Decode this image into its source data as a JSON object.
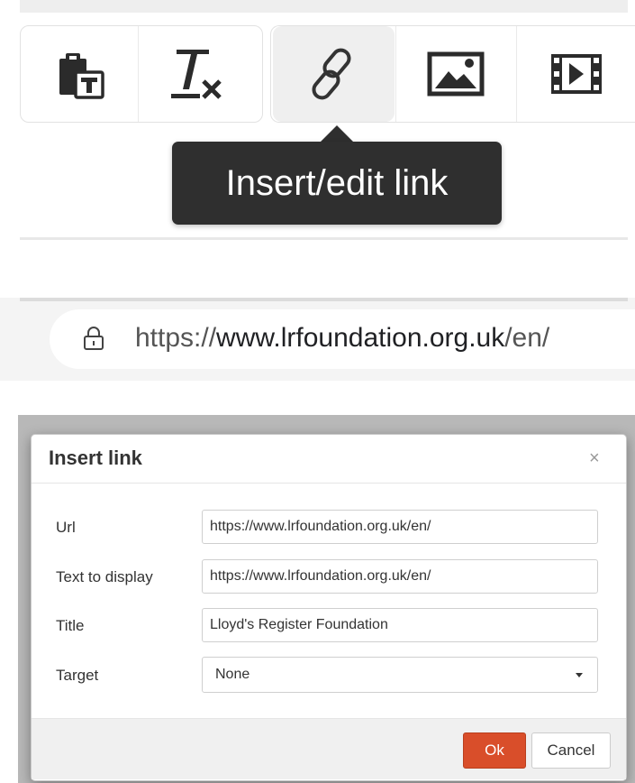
{
  "toolbar": {
    "buttons": [
      {
        "name": "paste-as-text",
        "icon": "clipboard-text-icon"
      },
      {
        "name": "clear-formatting",
        "icon": "remove-format-icon"
      },
      {
        "name": "insert-link",
        "icon": "link-icon",
        "active": true
      },
      {
        "name": "insert-image",
        "icon": "image-icon"
      },
      {
        "name": "insert-media",
        "icon": "film-icon"
      }
    ],
    "tooltip": "Insert/edit link"
  },
  "address_bar": {
    "scheme": "https://",
    "host": "www.lrfoundation.org.uk",
    "path": "/en/",
    "icon": "lock-icon"
  },
  "dialog": {
    "title": "Insert link",
    "close_glyph": "×",
    "fields": {
      "url": {
        "label": "Url",
        "value": "https://www.lrfoundation.org.uk/en/"
      },
      "text": {
        "label": "Text to display",
        "value": "https://www.lrfoundation.org.uk/en/"
      },
      "title": {
        "label": "Title",
        "value": "Lloyd's Register Foundation"
      },
      "target": {
        "label": "Target",
        "value": "None"
      }
    },
    "ok_label": "Ok",
    "cancel_label": "Cancel"
  },
  "colors": {
    "ok_button": "#d94e2a",
    "tooltip_bg": "#2f2f2f"
  }
}
